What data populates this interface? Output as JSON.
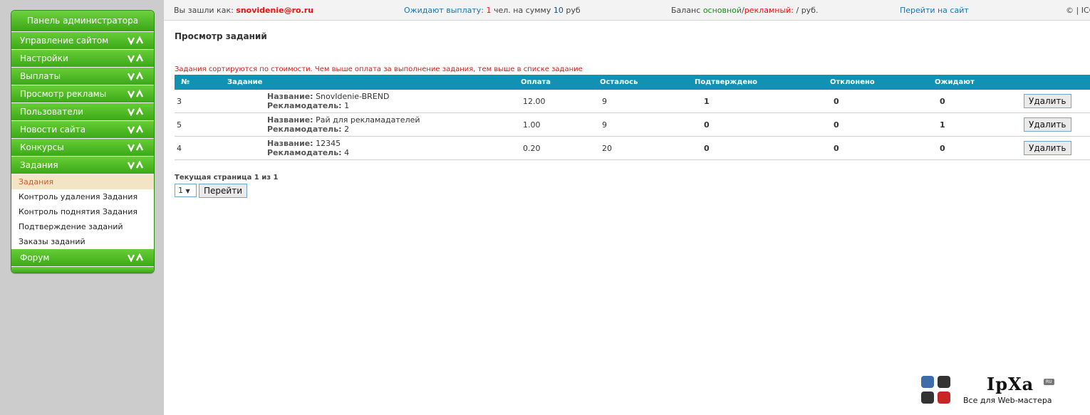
{
  "sidebar": {
    "title": "Панель администратора",
    "menu": [
      {
        "label": "Управление сайтом"
      },
      {
        "label": "Настройки"
      },
      {
        "label": "Выплаты"
      },
      {
        "label": "Просмотр рекламы"
      },
      {
        "label": "Пользователи"
      },
      {
        "label": "Новости сайта"
      },
      {
        "label": "Конкурсы"
      },
      {
        "label": "Задания"
      }
    ],
    "submenu": [
      {
        "label": "Задания"
      },
      {
        "label": "Контроль удаления Задания"
      },
      {
        "label": "Контроль поднятия Задания"
      },
      {
        "label": "Подтверждение заданий"
      },
      {
        "label": "Заказы заданий"
      }
    ],
    "last_item": "Форум"
  },
  "topbar": {
    "logged_prefix": "Вы зашли как:",
    "user": "snovidenie@ro.ru",
    "pending_prefix": "Ожидают выплату:",
    "pending_count": "1",
    "pending_mid": "чел. на сумму",
    "pending_sum": "10",
    "pending_unit": "руб",
    "balance_label": "Баланс",
    "balance_main": "основной",
    "balance_sep": "/",
    "balance_ad": "рекламный:",
    "balance_value": "/ руб.",
    "goto_site": "Перейти на сайт",
    "copyright": "© | ICO"
  },
  "main": {
    "title": "Просмотр заданий",
    "note": "Задания сортируются по стоимости. Чем выше оплата за выполнение задания, тем выше в списке задание",
    "columns": [
      "№",
      "Задание",
      "Оплата",
      "Осталось",
      "Подтверждено",
      "Отклонено",
      "Ожидают",
      ""
    ],
    "name_label": "Название:",
    "advertiser_label": "Рекламодатель:",
    "rows": [
      {
        "num": "3",
        "name": "SnovIdenie-BREND",
        "advertiser": "1",
        "pay": "12.00",
        "left": "9",
        "confirmed": "1",
        "rejected": "0",
        "waiting": "0",
        "action": "Удалить"
      },
      {
        "num": "5",
        "name": "Рай для рекламадателей",
        "advertiser": "2",
        "pay": "1.00",
        "left": "9",
        "confirmed": "0",
        "rejected": "0",
        "waiting": "1",
        "action": "Удалить"
      },
      {
        "num": "4",
        "name": "12345",
        "advertiser": "4",
        "pay": "0.20",
        "left": "20",
        "confirmed": "0",
        "rejected": "0",
        "waiting": "0",
        "action": "Удалить"
      }
    ],
    "pager_text": "Текущая страница 1 из 1",
    "page_value": "1",
    "go_label": "Перейти"
  },
  "logo": {
    "name": "IpXa",
    "badge": "RU",
    "tagline": "Все для Web-мастера"
  },
  "colors": {
    "accent_green": "#3ca918",
    "table_header": "#1192b3",
    "alert_red": "#d21a1a"
  }
}
